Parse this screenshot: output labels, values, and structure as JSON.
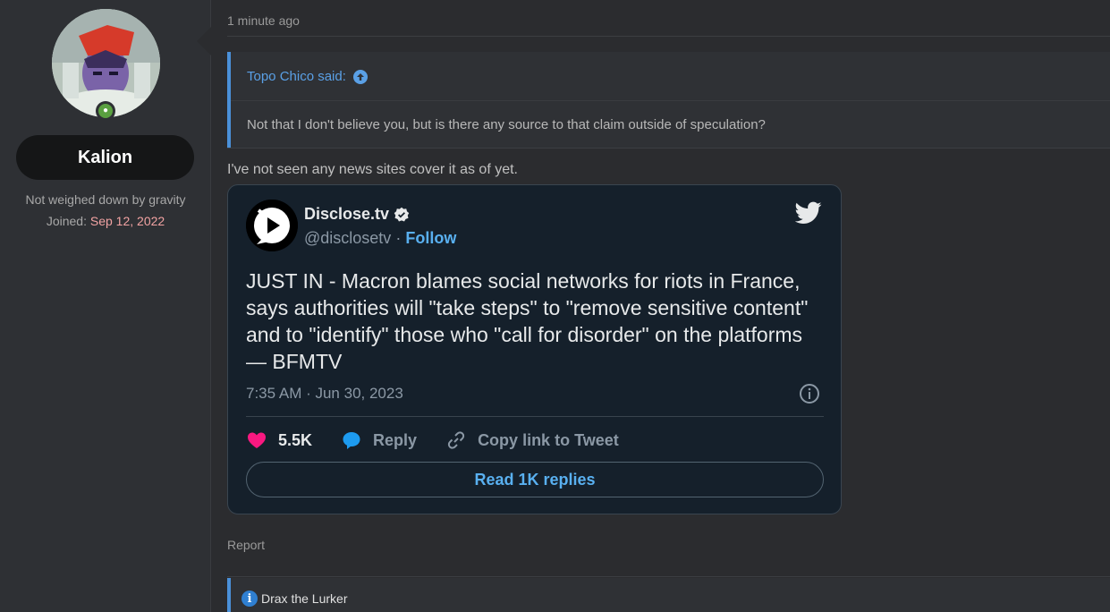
{
  "user": {
    "name": "Kalion",
    "title": "Not weighed down by gravity",
    "joined_label": "Joined:",
    "joined_date": "Sep 12, 2022"
  },
  "post": {
    "time": "1 minute ago",
    "quote": {
      "author": "Topo Chico said:",
      "text": "Not that I don't believe you, but is there any source to that claim outside of speculation?"
    },
    "body": "I've not seen any news sites cover it as of yet.",
    "report_label": "Report"
  },
  "tweet": {
    "name": "Disclose.tv",
    "handle": "@disclosetv",
    "separator": "·",
    "follow_label": "Follow",
    "text": "JUST IN - Macron blames social networks for riots in France, says authorities will \"take steps\" to \"remove sensitive content\" and to \"identify\" those who \"call for disorder\" on the platforms — BFMTV",
    "date": "7:35 AM · Jun 30, 2023",
    "likes": "5.5K",
    "reply_label": "Reply",
    "copy_label": "Copy link to Tweet",
    "read_replies_label": "Read 1K replies"
  },
  "next_post": {
    "quote_author": "Drax the Lurker"
  },
  "colors": {
    "accent_blue": "#4a90d9",
    "twitter_blue": "#59b0f0",
    "like_pink": "#f91880",
    "online_green": "#5aa040"
  }
}
